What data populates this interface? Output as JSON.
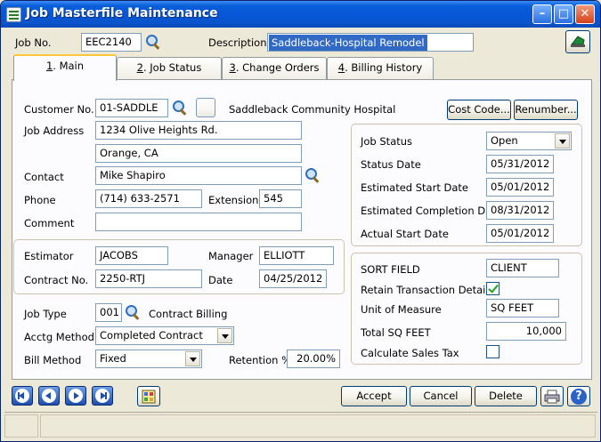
{
  "window": {
    "title": "Job Masterfile Maintenance"
  },
  "header": {
    "job_no_label": "Job No.",
    "job_no_value": "EEC2140",
    "description_label": "Description",
    "description_value": "Saddleback-Hospital Remodel"
  },
  "tabs": [
    {
      "num": "1",
      "label": ". Main"
    },
    {
      "num": "2",
      "label": ". Job Status"
    },
    {
      "num": "3",
      "label": ". Change Orders"
    },
    {
      "num": "4",
      "label": ". Billing History"
    }
  ],
  "customer": {
    "label": "Customer No.",
    "value": "01-SADDLE",
    "name": "Saddleback Community Hospital"
  },
  "buttons": {
    "cost_code": "Cost Code...",
    "renumber": "Renumber...",
    "accept": "Accept",
    "cancel": "Cancel",
    "delete": "Delete"
  },
  "address": {
    "label": "Job Address",
    "line1": "1234 Olive Heights Rd.",
    "line2": "Orange, CA"
  },
  "contact": {
    "label": "Contact",
    "value": "Mike Shapiro"
  },
  "phone": {
    "label": "Phone",
    "value": "(714) 633-2571",
    "ext_label": "Extension",
    "ext_value": "545"
  },
  "comment": {
    "label": "Comment",
    "value": ""
  },
  "estimator": {
    "label": "Estimator",
    "value": "JACOBS"
  },
  "manager": {
    "label": "Manager",
    "value": "ELLIOTT"
  },
  "contract": {
    "label": "Contract No.",
    "value": "2250-RTJ"
  },
  "date": {
    "label": "Date",
    "value": "04/25/2012"
  },
  "job_type": {
    "label": "Job Type",
    "value": "001",
    "desc": "Contract Billing"
  },
  "acctg_method": {
    "label": "Acctg Method",
    "value": "Completed Contract"
  },
  "bill_method": {
    "label": "Bill Method",
    "value": "Fixed"
  },
  "retention": {
    "label": "Retention %",
    "value": "20.00%"
  },
  "status": {
    "job_status_label": "Job Status",
    "job_status_value": "Open",
    "status_date_label": "Status Date",
    "status_date_value": "05/31/2012",
    "est_start_label": "Estimated Start Date",
    "est_start_value": "05/01/2012",
    "est_completion_label": "Estimated Completion Date",
    "est_completion_value": "08/31/2012",
    "actual_start_label": "Actual Start Date",
    "actual_start_value": "05/01/2012"
  },
  "extra": {
    "sort_field_label": "SORT FIELD",
    "sort_field_value": "CLIENT",
    "retain_label": "Retain Transaction Detail",
    "retain_checked": true,
    "uom_label": "Unit of Measure",
    "uom_value": "SQ FEET",
    "total_sq_label": "Total SQ FEET",
    "total_sq_value": "10,000",
    "calc_tax_label": "Calculate Sales Tax",
    "calc_tax_checked": false
  },
  "colors": {
    "titlebar": "#0756d9",
    "accent": "#316ac5",
    "tab_highlight": "#ffc83c"
  }
}
